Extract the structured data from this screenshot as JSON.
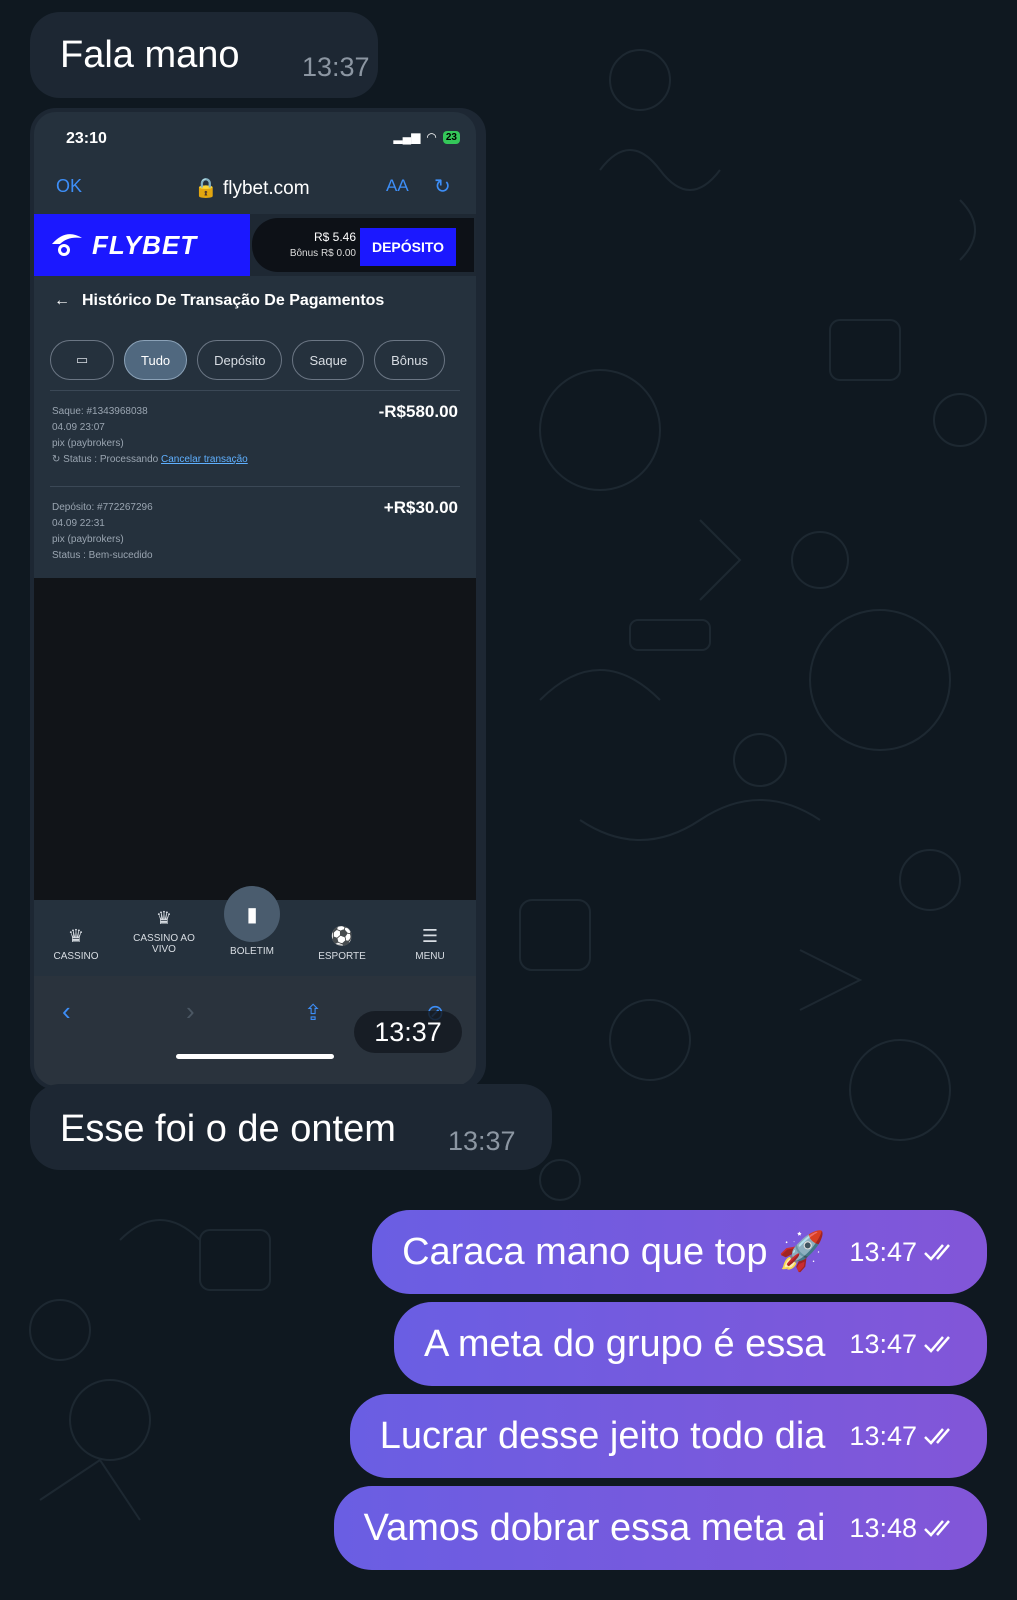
{
  "chat": {
    "incoming": [
      {
        "text": "Fala mano",
        "time": "13:37"
      },
      {
        "text": "Esse foi o de ontem",
        "time": "13:37"
      }
    ],
    "screenshot_time": "13:37",
    "outgoing": [
      {
        "text": "Caraca mano que top 🚀",
        "time": "13:47"
      },
      {
        "text": "A meta do grupo é essa",
        "time": "13:47"
      },
      {
        "text": "Lucrar desse jeito todo dia",
        "time": "13:47"
      },
      {
        "text": "Vamos dobrar essa meta ai",
        "time": "13:48"
      }
    ]
  },
  "phone": {
    "status_time": "23:10",
    "battery": "23",
    "url_bar": {
      "ok": "OK",
      "domain": "flybet.com",
      "aa": "AA"
    },
    "header": {
      "brand": "FLYBET",
      "balance": "R$ 5.46",
      "bonus": "Bônus R$ 0.00",
      "deposit_button": "DEPÓSITO"
    },
    "page_title": "Histórico De Transação De Pagamentos",
    "filters": [
      "Tudo",
      "Depósito",
      "Saque",
      "Bônus"
    ],
    "transactions": [
      {
        "title": "Saque: #1343968038",
        "date": "04.09 23:07",
        "method": "pix (paybrokers)",
        "status": "Status : Processando",
        "action": "Cancelar transação",
        "amount": "-R$580.00"
      },
      {
        "title": "Depósito: #772267296",
        "date": "04.09 22:31",
        "method": "pix (paybrokers)",
        "status": "Status : Bem-sucedido",
        "amount": "+R$30.00"
      }
    ],
    "bottom_nav": [
      "CASSINO",
      "CASSINO AO VIVO",
      "BOLETIM",
      "ESPORTE",
      "MENU"
    ]
  },
  "colors": {
    "background": "#0f1820",
    "incoming_bubble": "#1d2733",
    "outgoing_start": "#6a5ee3",
    "outgoing_end": "#8256d8",
    "brand_blue": "#1b18ff"
  }
}
